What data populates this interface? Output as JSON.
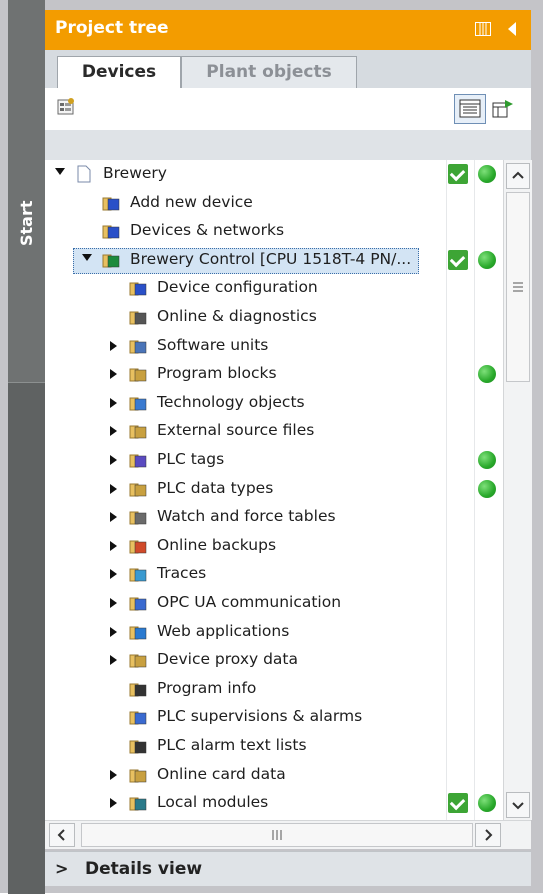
{
  "sidebar": {
    "label": "Start"
  },
  "header": {
    "title": "Project tree",
    "panel_icon": "pane-layout-icon",
    "collapse_icon": "collapse-left-icon"
  },
  "tabs": [
    {
      "label": "Devices",
      "active": true
    },
    {
      "label": "Plant objects",
      "active": false
    }
  ],
  "toolbar": {
    "left_icon": "properties-icon",
    "right_icons": [
      "table-view-icon",
      "export-icon"
    ]
  },
  "tree": {
    "rows": [
      {
        "label": "Brewery",
        "expand": "down",
        "icon": "project-icon",
        "check": true,
        "dot": true
      },
      {
        "label": "Add new device",
        "expand": "none",
        "icon": "add-device-icon",
        "check": false,
        "dot": false
      },
      {
        "label": "Devices & networks",
        "expand": "none",
        "icon": "network-icon",
        "check": false,
        "dot": false
      },
      {
        "label": "Brewery Control [CPU 1518T-4 PN/...",
        "expand": "down",
        "icon": "cpu-icon",
        "check": true,
        "dot": true,
        "selected": true
      },
      {
        "label": "Device configuration",
        "expand": "none",
        "icon": "device-config-icon",
        "check": false,
        "dot": false
      },
      {
        "label": "Online & diagnostics",
        "expand": "none",
        "icon": "diagnostics-icon",
        "check": false,
        "dot": false
      },
      {
        "label": "Software units",
        "expand": "right",
        "icon": "software-units-icon",
        "check": false,
        "dot": false
      },
      {
        "label": "Program blocks",
        "expand": "right",
        "icon": "program-blocks-icon",
        "check": false,
        "dot": true
      },
      {
        "label": "Technology objects",
        "expand": "right",
        "icon": "technology-objects-icon",
        "check": false,
        "dot": false
      },
      {
        "label": "External source files",
        "expand": "right",
        "icon": "source-files-icon",
        "check": false,
        "dot": false
      },
      {
        "label": "PLC tags",
        "expand": "right",
        "icon": "plc-tags-icon",
        "check": false,
        "dot": true
      },
      {
        "label": "PLC data types",
        "expand": "right",
        "icon": "data-types-icon",
        "check": false,
        "dot": true
      },
      {
        "label": "Watch and force tables",
        "expand": "right",
        "icon": "watch-tables-icon",
        "check": false,
        "dot": false
      },
      {
        "label": "Online backups",
        "expand": "right",
        "icon": "backups-icon",
        "check": false,
        "dot": false
      },
      {
        "label": "Traces",
        "expand": "right",
        "icon": "traces-icon",
        "check": false,
        "dot": false
      },
      {
        "label": "OPC UA communication",
        "expand": "right",
        "icon": "opcua-icon",
        "check": false,
        "dot": false
      },
      {
        "label": "Web applications",
        "expand": "right",
        "icon": "web-apps-icon",
        "check": false,
        "dot": false
      },
      {
        "label": "Device proxy data",
        "expand": "right",
        "icon": "proxy-data-icon",
        "check": false,
        "dot": false
      },
      {
        "label": "Program info",
        "expand": "none",
        "icon": "program-info-icon",
        "check": false,
        "dot": false
      },
      {
        "label": "PLC supervisions & alarms",
        "expand": "none",
        "icon": "alarms-icon",
        "check": false,
        "dot": false
      },
      {
        "label": "PLC alarm text lists",
        "expand": "none",
        "icon": "text-lists-icon",
        "check": false,
        "dot": false
      },
      {
        "label": "Online card data",
        "expand": "right",
        "icon": "card-data-icon",
        "check": false,
        "dot": false
      },
      {
        "label": "Local modules",
        "expand": "right",
        "icon": "local-modules-icon",
        "check": true,
        "dot": true
      }
    ]
  },
  "details": {
    "label": "Details view"
  },
  "colors": {
    "header_bg": "#f39c00",
    "ok_green": "#3da535",
    "selection": "#d3e4f4"
  }
}
